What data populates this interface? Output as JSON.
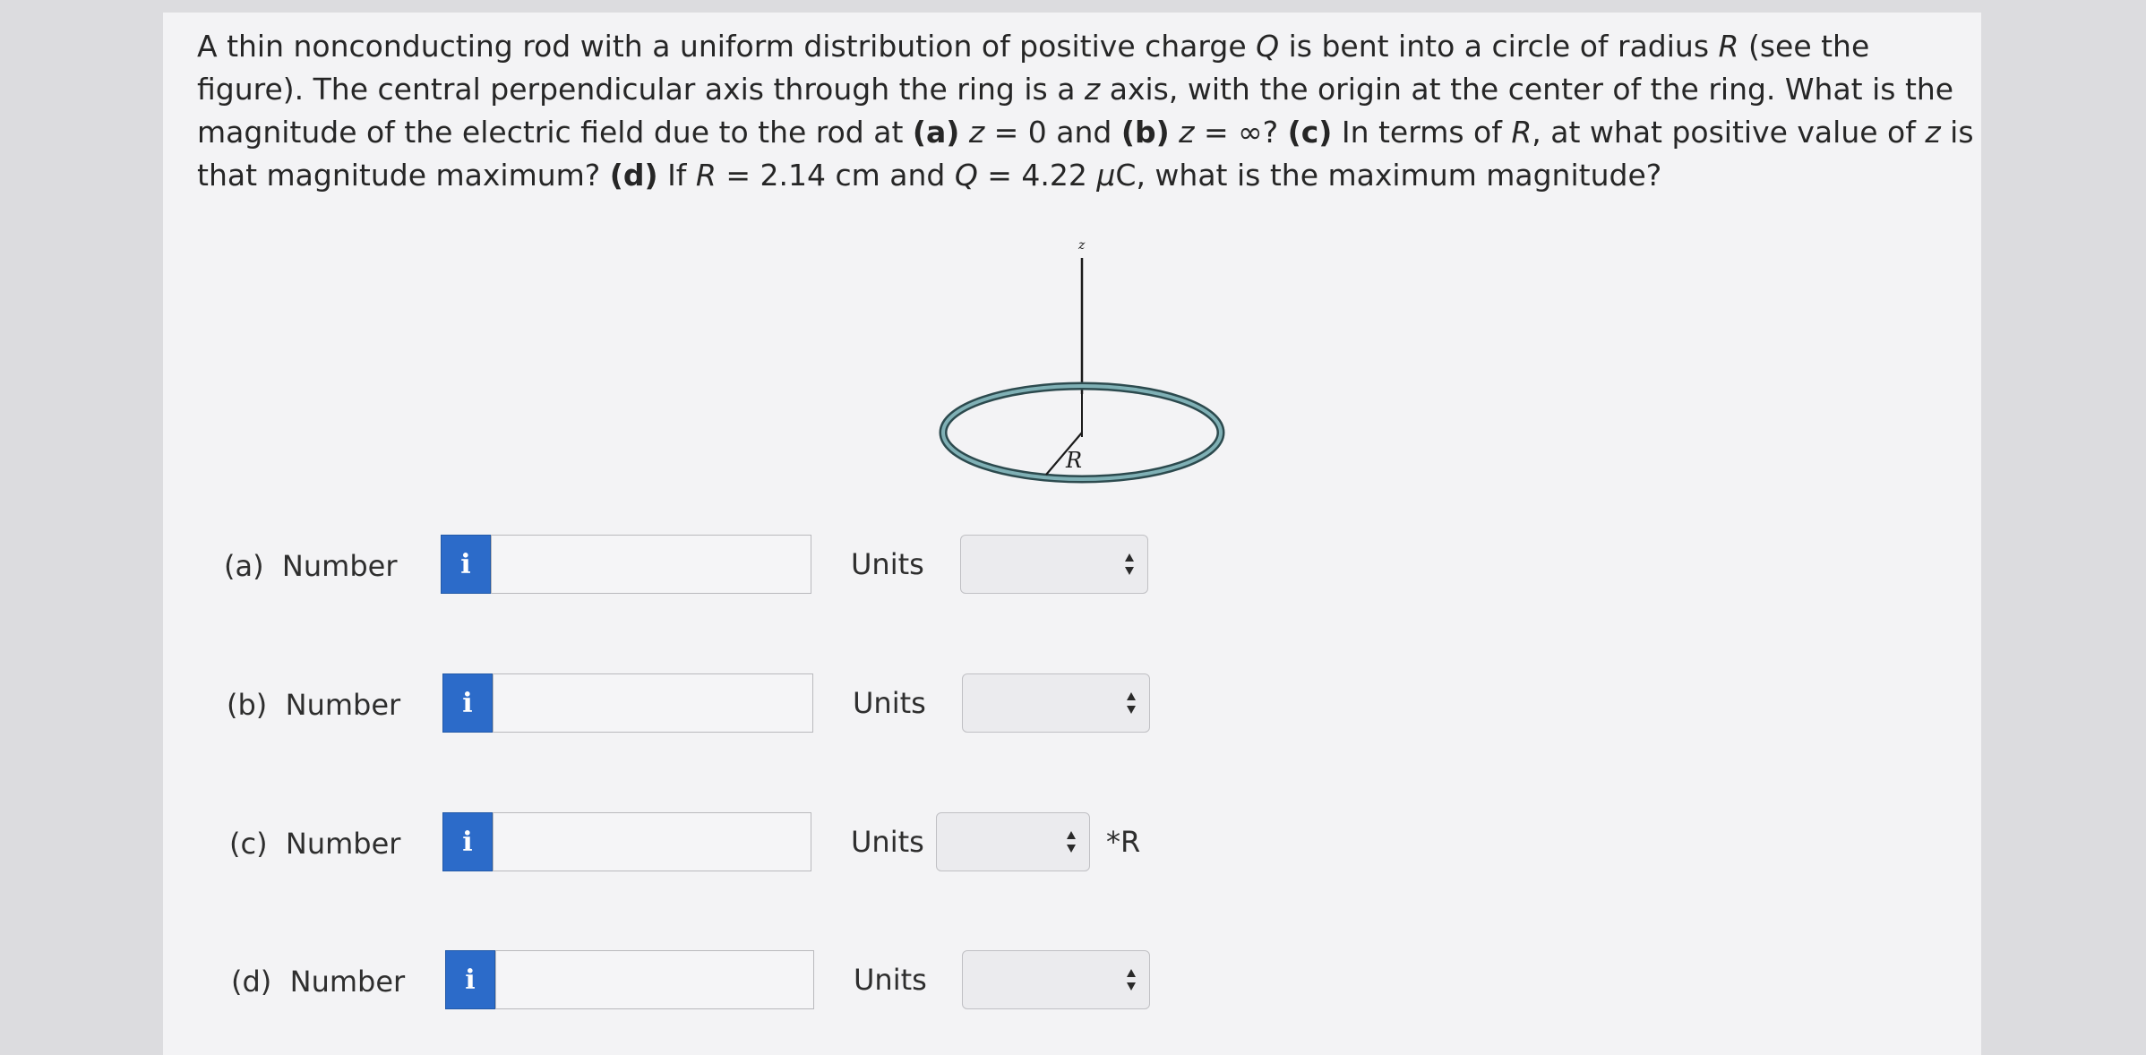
{
  "question": {
    "segments": [
      {
        "t": "A thin nonconducting rod with a uniform distribution of positive charge ",
        "s": ""
      },
      {
        "t": "Q",
        "s": "i"
      },
      {
        "t": " is bent into a circle of radius ",
        "s": ""
      },
      {
        "t": "R",
        "s": "i"
      },
      {
        "t": " (see the figure). The central perpendicular axis through the ring is a ",
        "s": ""
      },
      {
        "t": "z",
        "s": "i"
      },
      {
        "t": " axis, with the origin at the center of the ring. What is the magnitude of the electric field due to the rod at ",
        "s": ""
      },
      {
        "t": "(a)",
        "s": "b"
      },
      {
        "t": " ",
        "s": ""
      },
      {
        "t": "z",
        "s": "i"
      },
      {
        "t": " = 0 and ",
        "s": ""
      },
      {
        "t": "(b)",
        "s": "b"
      },
      {
        "t": " ",
        "s": ""
      },
      {
        "t": "z",
        "s": "i"
      },
      {
        "t": " = ∞? ",
        "s": ""
      },
      {
        "t": "(c)",
        "s": "b"
      },
      {
        "t": " In terms of ",
        "s": ""
      },
      {
        "t": "R",
        "s": "i"
      },
      {
        "t": ", at what positive value of ",
        "s": ""
      },
      {
        "t": "z",
        "s": "i"
      },
      {
        "t": " is that magnitude maximum? ",
        "s": ""
      },
      {
        "t": "(d)",
        "s": "b"
      },
      {
        "t": " If ",
        "s": ""
      },
      {
        "t": "R",
        "s": "i"
      },
      {
        "t": " = 2.14 cm and ",
        "s": ""
      },
      {
        "t": "Q",
        "s": "i"
      },
      {
        "t": " = 4.22 ",
        "s": ""
      },
      {
        "t": "μ",
        "s": "i"
      },
      {
        "t": "C, what is the maximum magnitude?",
        "s": ""
      }
    ]
  },
  "figure": {
    "axis_label": "z",
    "radius_label": "R"
  },
  "parts": [
    {
      "label": "(a)",
      "number_label": "Number",
      "info_icon": "i",
      "value": "",
      "units_label": "Units",
      "units_value": "",
      "suffix": ""
    },
    {
      "label": "(b)",
      "number_label": "Number",
      "info_icon": "i",
      "value": "",
      "units_label": "Units",
      "units_value": "",
      "suffix": ""
    },
    {
      "label": "(c)",
      "number_label": "Number",
      "info_icon": "i",
      "value": "",
      "units_label": "Units",
      "units_value": "",
      "suffix": "*R"
    },
    {
      "label": "(d)",
      "number_label": "Number",
      "info_icon": "i",
      "value": "",
      "units_label": "Units",
      "units_value": "",
      "suffix": ""
    }
  ],
  "colors": {
    "info_button": "#2c6bc9",
    "ring": "#5e8f95"
  }
}
